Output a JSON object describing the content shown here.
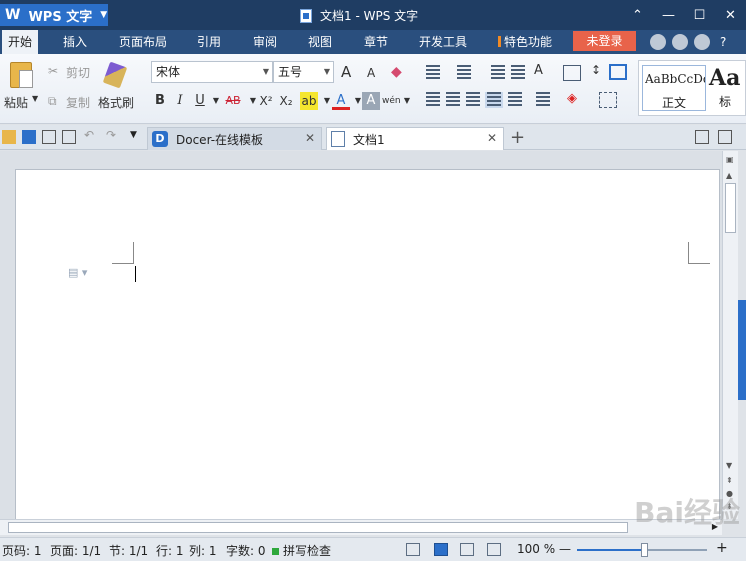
{
  "app": {
    "name": "WPS 文字",
    "logo_char": "W",
    "window_title": "文档1 - WPS 文字"
  },
  "window_controls": {
    "minimize": "—",
    "maximize": "☐",
    "close": "✕",
    "collapse": "⌃"
  },
  "menu": {
    "tabs": [
      {
        "label": "开始",
        "active": true
      },
      {
        "label": "插入"
      },
      {
        "label": "页面布局"
      },
      {
        "label": "引用"
      },
      {
        "label": "审阅"
      },
      {
        "label": "视图"
      },
      {
        "label": "章节"
      },
      {
        "label": "开发工具"
      },
      {
        "label": "特色功能"
      }
    ],
    "login_label": "未登录",
    "help_label": "?"
  },
  "ribbon": {
    "paste_label": "粘贴",
    "cut_label": "剪切",
    "copy_label": "复制",
    "format_painter_label": "格式刷",
    "font_name": "宋体",
    "font_size": "五号",
    "bold": "B",
    "italic": "I",
    "underline": "U",
    "strikethrough": "AB",
    "superscript": "X²",
    "subscript": "X₂",
    "font_color": "A",
    "char_shading": "A",
    "phonetic": "wén",
    "grow_font": "A",
    "shrink_font": "A",
    "styles": {
      "sample_text": "AaBbCcDd",
      "normal_label": "正文",
      "heading_sample": "Aa",
      "heading_label": "标"
    }
  },
  "doc_tabs": [
    {
      "label": "Docer-在线模板",
      "active": false
    },
    {
      "label": "文档1",
      "active": true
    }
  ],
  "status": {
    "page_code": "页码: 1",
    "pages": "页面: 1/1",
    "section": "节: 1/1",
    "row": "行: 1",
    "col": "列: 1",
    "word_count": "字数: 0",
    "spell_check": "拼写检查",
    "zoom": "100 %",
    "zoom_minus": "—",
    "zoom_plus": "+",
    "zoom_level_fraction": 0.52
  },
  "colors": {
    "titlebar": "#1f3d63",
    "accent": "#2b6fc9",
    "login": "#e8634a"
  },
  "watermark": "Bai经验"
}
